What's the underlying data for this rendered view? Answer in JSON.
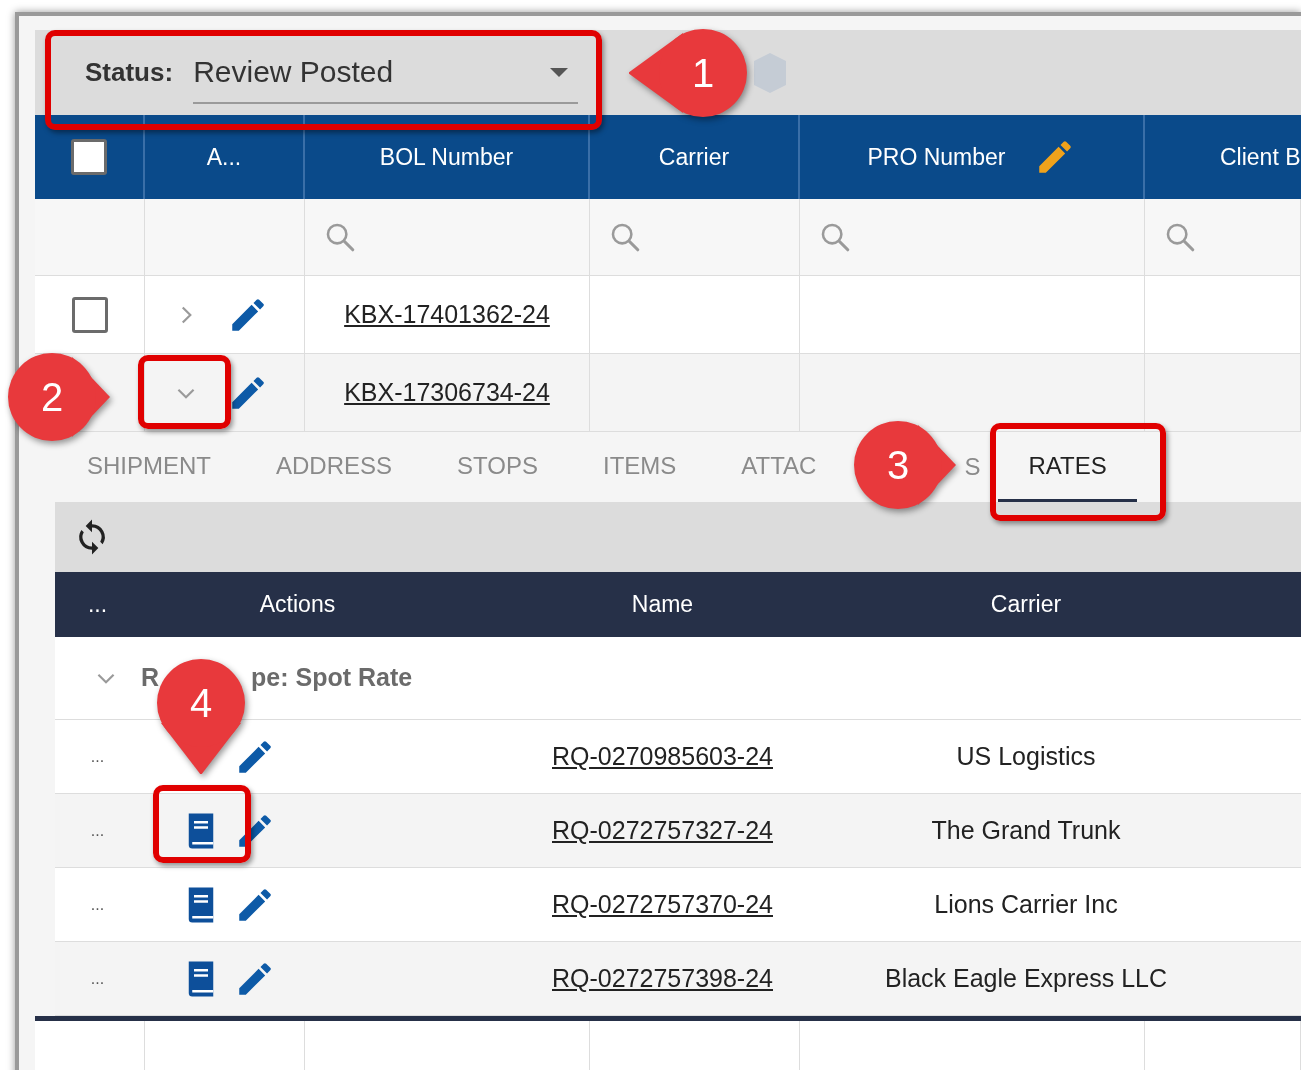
{
  "status_filter": {
    "label": "Status:",
    "value": "Review Posted"
  },
  "table": {
    "columns": [
      {
        "kind": "checkbox",
        "checked": false
      },
      {
        "kind": "text",
        "label": "A...",
        "filter": false
      },
      {
        "kind": "text",
        "label": "BOL Number",
        "filter": true
      },
      {
        "kind": "text",
        "label": "Carrier",
        "filter": true
      },
      {
        "kind": "edit",
        "label": "PRO Number",
        "filter": true
      },
      {
        "kind": "text",
        "label": "Client B",
        "filter": true
      }
    ],
    "rows": [
      {
        "checked": false,
        "expanded": false,
        "bol": "KBX-17401362-24"
      },
      {
        "expanded": true,
        "bol": "KBX-17306734-24"
      }
    ]
  },
  "detail": {
    "tabs": [
      {
        "label": "SHIPMENT",
        "selected": false
      },
      {
        "label": "ADDRESS",
        "selected": false
      },
      {
        "label": "STOPS",
        "selected": false
      },
      {
        "label": "ITEMS",
        "selected": false
      },
      {
        "label": "ATTAC",
        "tail": "S",
        "selected": false
      },
      {
        "label": "RATES",
        "selected": true
      }
    ],
    "rates": {
      "columns": [
        "...",
        "Actions",
        "Name",
        "Carrier"
      ],
      "group": {
        "expanded": true,
        "label": "R",
        "tail": "pe: Spot Rate"
      },
      "rows": [
        {
          "menu": "...",
          "book_icon": false,
          "name": "RQ-0270985603-24",
          "carrier": "US Logistics"
        },
        {
          "menu": "...",
          "book_icon": true,
          "name": "RQ-0272757327-24",
          "carrier": "The Grand Trunk"
        },
        {
          "menu": "...",
          "book_icon": true,
          "name": "RQ-0272757370-24",
          "carrier": "Lions Carrier Inc"
        },
        {
          "menu": "...",
          "book_icon": true,
          "name": "RQ-0272757398-24",
          "carrier": "Black Eagle Express LLC"
        }
      ]
    }
  },
  "annotations": [
    {
      "number": "1"
    },
    {
      "number": "2"
    },
    {
      "number": "3"
    },
    {
      "number": "4"
    }
  ]
}
